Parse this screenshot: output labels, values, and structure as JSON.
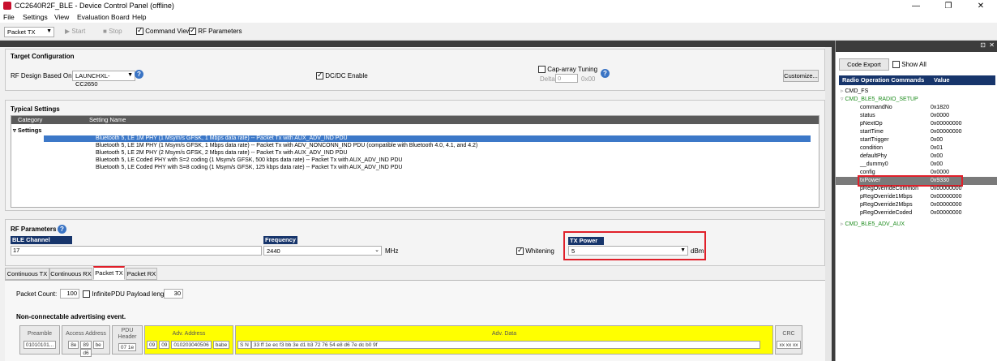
{
  "window": {
    "title": "CC2640R2F_BLE - Device Control Panel (offline)",
    "min": "—",
    "max": "❐",
    "close": "✕"
  },
  "menu": [
    "File",
    "Settings",
    "View",
    "Evaluation Board",
    "Help"
  ],
  "toolbar": {
    "mode": "Packet TX",
    "start": "Start",
    "stop": "Stop",
    "command_view": "Command View",
    "rf_parameters": "RF Parameters"
  },
  "target": {
    "title": "Target Configuration",
    "rf_design_label": "RF Design Based On:",
    "rf_design_value": "LAUNCHXL-CC2650",
    "dcdc": "DC/DC Enable",
    "cap_array": "Cap-array Tuning",
    "delta_label": "Delta",
    "delta_value": "0",
    "hex_value": "0x00",
    "customize": "Customize..."
  },
  "typical": {
    "title": "Typical Settings",
    "col_category": "Category",
    "col_setting": "Setting Name",
    "group": "Settings",
    "rows": [
      "Bluetooth 5, LE 1M PHY (1 Msym/s GFSK, 1 Mbps data rate) -- Packet Tx with AUX_ADV_IND PDU",
      "Bluetooth 5, LE 1M PHY (1 Msym/s GFSK, 1 Mbps data rate) -- Packet Tx with ADV_NONCONN_IND PDU (compatible with Bluetooth 4.0, 4.1, and 4.2)",
      "Bluetooth 5, LE 2M PHY (2 Msym/s GFSK, 2 Mbps  data rate) -- Packet Tx with AUX_ADV_IND PDU",
      "Bluetooth 5, LE Coded PHY with S=2 coding (1 Msym/s GFSK, 500 kbps data rate) -- Packet Tx with AUX_ADV_IND PDU",
      "Bluetooth 5, LE Coded PHY with S=8 coding (1 Msym/s GFSK, 125 kbps data rate) -- Packet Tx with AUX_ADV_IND PDU"
    ]
  },
  "rf": {
    "title": "RF Parameters",
    "ble_channel_label": "BLE Channel",
    "ble_channel_value": "17",
    "frequency_label": "Frequency",
    "frequency_value": "2440",
    "frequency_unit": "MHz",
    "whitening": "Whitening",
    "tx_power_label": "TX Power",
    "tx_power_value": "5",
    "tx_power_unit": "dBm"
  },
  "tabs": [
    "Continuous TX",
    "Continuous RX",
    "Packet TX",
    "Packet RX"
  ],
  "packet": {
    "count_label": "Packet Count:",
    "count_value": "100",
    "infinite": "Infinite",
    "payload_label": "PDU Payload length:",
    "payload_value": "30",
    "event": "Non-connectable advertising event.",
    "preamble": "Preamble",
    "preamble_val": "01010101...",
    "access": "Access Address",
    "access_bytes": [
      "8e",
      "89",
      "be",
      "d6"
    ],
    "pdu_header_1": "PDU",
    "pdu_header_2": "Header",
    "pdu_header_val": "07 1e",
    "adv_address": "Adv. Address",
    "adv_addr_bytes": [
      "09",
      "09",
      "010203040506",
      "babe"
    ],
    "adv_data": "Adv. Data",
    "adv_data_sn": "S N",
    "adv_data_val": "33 ff 1e ec f3 bb 3e d1 b3 72 76 54 e8 d6 7e dc b0 9f",
    "crc": "CRC",
    "crc_val": "xx xx xx"
  },
  "right": {
    "code_export": "Code Export",
    "show_all": "Show All",
    "col_cmd": "Radio Operation Commands",
    "col_val": "Value",
    "cmd_fs": "CMD_FS",
    "cmd_setup": "CMD_BLE5_RADIO_SETUP",
    "params": [
      {
        "n": "commandNo",
        "v": "0x1820"
      },
      {
        "n": "status",
        "v": "0x0000"
      },
      {
        "n": "pNextOp",
        "v": "0x00000000"
      },
      {
        "n": "startTime",
        "v": "0x00000000"
      },
      {
        "n": "startTrigger",
        "v": "0x00"
      },
      {
        "n": "condition",
        "v": "0x01"
      },
      {
        "n": "defaultPhy",
        "v": "0x00"
      },
      {
        "n": "__dummy0",
        "v": "0x00"
      },
      {
        "n": "config",
        "v": "0x0000"
      },
      {
        "n": "txPower",
        "v": "0x9330"
      },
      {
        "n": "pRegOverrideCommon",
        "v": "0x00000000"
      },
      {
        "n": "pRegOverride1Mbps",
        "v": "0x00000000"
      },
      {
        "n": "pRegOverride2Mbps",
        "v": "0x00000000"
      },
      {
        "n": "pRegOverrideCoded",
        "v": "0x00000000"
      }
    ],
    "cmd_aux": "CMD_BLE5_ADV_AUX"
  }
}
